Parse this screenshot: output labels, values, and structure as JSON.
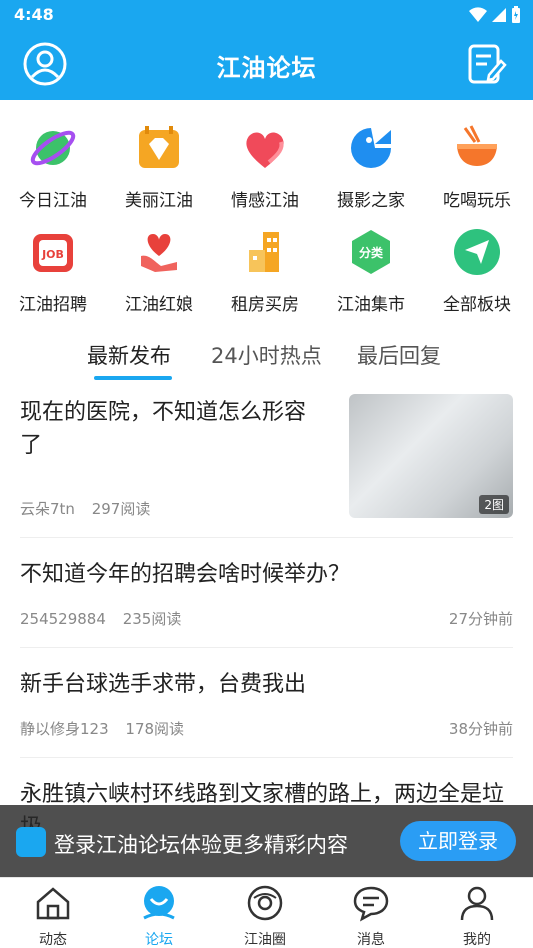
{
  "status_bar": {
    "time": "4:48"
  },
  "app_bar": {
    "title": "江油论坛"
  },
  "categories": [
    {
      "label": "今日江油",
      "icon": "planet-icon"
    },
    {
      "label": "美丽江油",
      "icon": "diamond-icon"
    },
    {
      "label": "情感江油",
      "icon": "heart-icon"
    },
    {
      "label": "摄影之家",
      "icon": "camera-c-icon"
    },
    {
      "label": "吃喝玩乐",
      "icon": "bowl-icon"
    },
    {
      "label": "江油招聘",
      "icon": "job-icon"
    },
    {
      "label": "江油红娘",
      "icon": "hand-heart-icon"
    },
    {
      "label": "租房买房",
      "icon": "building-icon"
    },
    {
      "label": "江油集市",
      "icon": "market-icon"
    },
    {
      "label": "全部板块",
      "icon": "send-icon"
    }
  ],
  "tabs": [
    {
      "label": "最新发布",
      "active": true
    },
    {
      "label": "24小时热点",
      "active": false
    },
    {
      "label": "最后回复",
      "active": false
    }
  ],
  "posts": [
    {
      "title": "现在的医院，不知道怎么形容了",
      "author": "云朵7tn",
      "reads": "297阅读",
      "time": "",
      "image_count": "2图"
    },
    {
      "title": "不知道今年的招聘会啥时候举办？",
      "author": "254529884",
      "reads": "235阅读",
      "time": "27分钟前"
    },
    {
      "title": "新手台球选手求带，台费我出",
      "author": "静以修身123",
      "reads": "178阅读",
      "time": "38分钟前"
    },
    {
      "title": "永胜镇六峡村环线路到文家槽的路上，两边全是垃圾",
      "author": "",
      "reads": "",
      "time": ""
    }
  ],
  "login_banner": {
    "text": "登录江油论坛体验更多精彩内容",
    "button": "立即登录"
  },
  "bottom_nav": [
    {
      "label": "动态",
      "active": false
    },
    {
      "label": "论坛",
      "active": true
    },
    {
      "label": "江油圈",
      "active": false
    },
    {
      "label": "消息",
      "active": false
    },
    {
      "label": "我的",
      "active": false
    }
  ],
  "colors": {
    "brand": "#1aa7f0",
    "active_tab": "#1aa7f0"
  }
}
